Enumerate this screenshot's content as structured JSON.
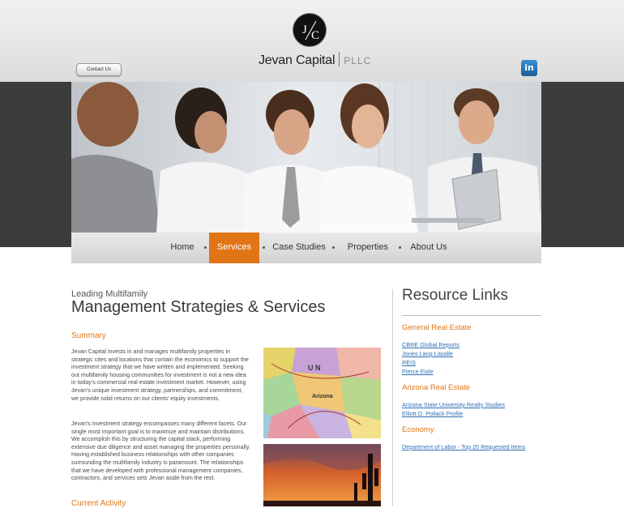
{
  "header": {
    "logo_monogram": "J/C",
    "brand_name": "Jevan Capital",
    "brand_suffix": "PLLC",
    "contact_button": "Contact Us",
    "linkedin_label": "in"
  },
  "nav": {
    "items": [
      {
        "label": "Home",
        "active": false
      },
      {
        "label": "Services",
        "active": true
      },
      {
        "label": "Case Studies",
        "active": false
      },
      {
        "label": "Properties",
        "active": false
      },
      {
        "label": "About Us",
        "active": false
      }
    ]
  },
  "main": {
    "kicker": "Leading Multifamily",
    "title": "Management Strategies & Services",
    "summary_heading": "Summary",
    "paragraphs": [
      "Jevan Capital invests in and manages multifamily properties in strategic cites and locations that contain the economics to support the investment strategy that we have written and implemented. Seeking out multifamily housing communities for investment is not a new idea in today's commercial real estate investment market. However, using Jevan's unique investment strategy, partnerships, and commitment, we provide solid returns on our clients' equity investments.",
      "Jevan's investment strategy encompasses many different facets. Our single most important goal is to maximize and maintain distributions. We accomplish this by structuring the capital stack, performing extensive due diligence and asset managing the properties personally. Having established business relationships with other companies surrounding the multifamily industry is paramount. The relationships that we have developed with professional management companies, contractors, and services sets Jevan aside from the rest."
    ],
    "current_activity_heading": "Current Activity"
  },
  "sidebar": {
    "title": "Resource Links",
    "groups": [
      {
        "heading": "General Real Estate",
        "links": [
          "CBRE Global Reports",
          "Jones Lang Lasalle",
          "REIS",
          "Pierce Eisle"
        ]
      },
      {
        "heading": "Arizona Real Estate",
        "links": [
          "Arizona State University Realty Studies",
          "Elliott D. Pollack Profile"
        ]
      },
      {
        "heading": "Economy",
        "links": [
          "Department of Labor - Top 20 Requested Items"
        ]
      }
    ]
  },
  "colors": {
    "accent": "#e07516",
    "link": "#2f6fb5",
    "dark_band": "#3c3c3c"
  }
}
